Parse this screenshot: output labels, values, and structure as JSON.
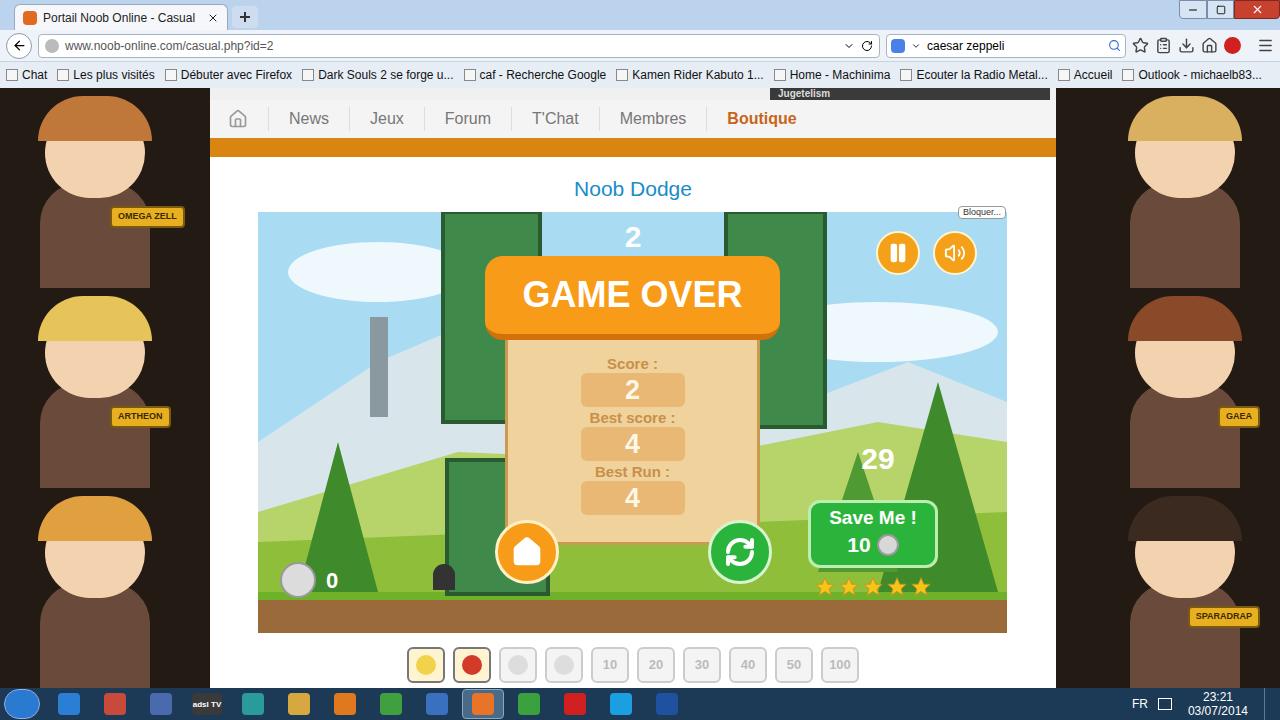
{
  "browser": {
    "tab": {
      "title": "Portail Noob Online - Casual",
      "selected": true
    },
    "url": "www.noob-online.com/casual.php?id=2",
    "search": {
      "value": "caesar zeppeli"
    },
    "bookmarks": [
      {
        "label": "Chat"
      },
      {
        "label": "Les plus visités"
      },
      {
        "label": "Débuter avec Firefox"
      },
      {
        "label": "Dark Souls 2 se forge u..."
      },
      {
        "label": "caf - Recherche Google"
      },
      {
        "label": "Kamen Rider Kabuto 1..."
      },
      {
        "label": "Home - Machinima"
      },
      {
        "label": "Ecouter la Radio Metal..."
      },
      {
        "label": "Accueil"
      },
      {
        "label": "Outlook - michaelb83..."
      }
    ]
  },
  "site": {
    "top_banner": "Jugetelism",
    "nav": [
      {
        "label": "News",
        "selected": false
      },
      {
        "label": "Jeux",
        "selected": false
      },
      {
        "label": "Forum",
        "selected": false
      },
      {
        "label": "T'Chat",
        "selected": false
      },
      {
        "label": "Membres",
        "selected": false
      },
      {
        "label": "Boutique",
        "selected": true
      }
    ],
    "title": "Noob Dodge",
    "block_label": "Bloquer..."
  },
  "left_characters": [
    {
      "label": "OMEGA ZELL",
      "hair": "#c0783a"
    },
    {
      "label": "ARTHEON",
      "hair": "#e6c45a"
    },
    {
      "hair": "#e0a040"
    }
  ],
  "right_characters": [
    {
      "hair": "#d8b060"
    },
    {
      "label": "GAEA",
      "hair": "#8a4a2a"
    },
    {
      "label": "SPARADRAP",
      "hair": "#3a2a20"
    }
  ],
  "game": {
    "current_score": "2",
    "game_over": "GAME OVER",
    "score_label": "Score :",
    "score": "2",
    "best_score_label": "Best score :",
    "best_score": "4",
    "best_run_label": "Best Run :",
    "best_run": "4",
    "countdown": "29",
    "save_me": {
      "label": "Save Me !",
      "cost": "10"
    },
    "stars": 5,
    "coins": "0"
  },
  "achievements": [
    {
      "unlocked": true,
      "color": "#f2d24a"
    },
    {
      "unlocked": true,
      "color": "#d23a2a"
    },
    {
      "unlocked": false
    },
    {
      "unlocked": false
    },
    {
      "text": "10",
      "unlocked": false
    },
    {
      "text": "20",
      "unlocked": false
    },
    {
      "text": "30",
      "unlocked": false
    },
    {
      "text": "40",
      "unlocked": false
    },
    {
      "text": "50",
      "unlocked": false
    },
    {
      "text": "100",
      "unlocked": false
    }
  ],
  "taskbar": {
    "apps": [
      {
        "color": "#2a7fd4",
        "selected": false
      },
      {
        "color": "#c84a3a",
        "selected": false
      },
      {
        "color": "#4a6ab0",
        "selected": false
      },
      {
        "color": "#3a3a3a",
        "label": "adsl TV",
        "selected": false
      },
      {
        "color": "#2a9a9a",
        "selected": false
      },
      {
        "color": "#d8a840",
        "selected": false
      },
      {
        "color": "#e07820",
        "selected": false
      },
      {
        "color": "#40a040",
        "selected": false
      },
      {
        "color": "#3a70c0",
        "selected": false
      },
      {
        "color": "#e8742a",
        "selected": true
      },
      {
        "color": "#3aa040",
        "selected": false
      },
      {
        "color": "#d02020",
        "selected": false
      },
      {
        "color": "#1aa0e0",
        "selected": false
      },
      {
        "color": "#2050a0",
        "selected": false
      }
    ],
    "language": "FR",
    "time": "23:21",
    "date": "03/07/2014"
  }
}
